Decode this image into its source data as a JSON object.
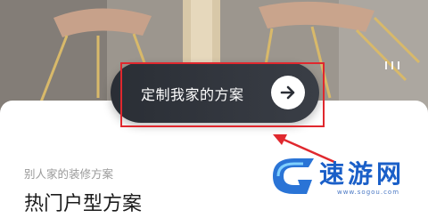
{
  "hero": {
    "image_icon": "dining-room-photo",
    "pager_dots": 3
  },
  "cta": {
    "label": "定制我家的方案",
    "arrow_icon": "arrow-right-icon"
  },
  "annotation": {
    "highlight_color": "#e0282e",
    "arrow_icon": "pointer-arrow-icon"
  },
  "section": {
    "subtitle": "别人家的装修方案",
    "title": "热门户型方案"
  },
  "watermark": {
    "name": "速游网",
    "url": "www.sogou.com"
  },
  "colors": {
    "cta_background": "#2f333a",
    "title_text": "#1c1c1c",
    "subtitle_text": "#9a9a9a",
    "watermark_blue": "#1a5fc8"
  }
}
